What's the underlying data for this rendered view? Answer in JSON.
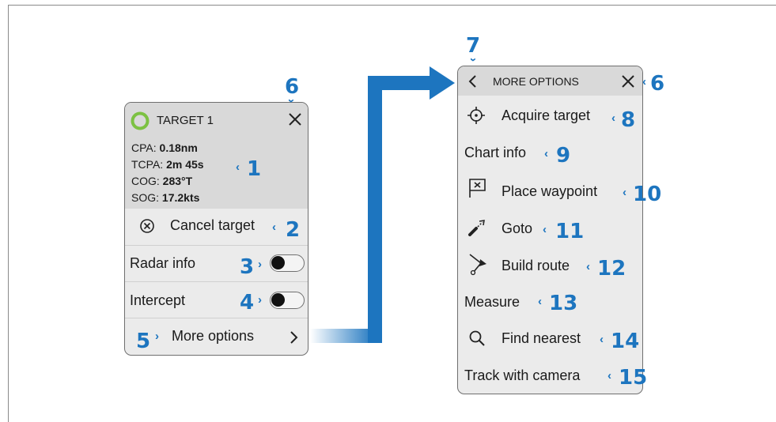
{
  "colors": {
    "accent": "#1d75bf",
    "target_ring": "#7cc142",
    "panel_bg": "#ebebeb",
    "panel_header": "#d9d9d9"
  },
  "left_panel": {
    "title": "TARGET 1",
    "info": [
      {
        "label": "CPA: ",
        "value": "0.18nm"
      },
      {
        "label": "TCPA: ",
        "value": "2m 45s"
      },
      {
        "label": "COG: ",
        "value": "283°T"
      },
      {
        "label": "SOG: ",
        "value": "17.2kts"
      }
    ],
    "cancel_label": "Cancel target",
    "radar_info_label": "Radar info",
    "intercept_label": "Intercept",
    "more_options_label": "More options",
    "radar_info_on": false,
    "intercept_on": false
  },
  "right_panel": {
    "title": "MORE OPTIONS",
    "items": [
      {
        "label": "Acquire target",
        "icon": "crosshair-icon"
      },
      {
        "label": "Chart info",
        "icon": ""
      },
      {
        "label": "Place waypoint",
        "icon": "waypoint-flag-icon"
      },
      {
        "label": "Goto",
        "icon": "goto-arrow-icon"
      },
      {
        "label": "Build route",
        "icon": "route-icon"
      },
      {
        "label": "Measure",
        "icon": ""
      },
      {
        "label": "Find nearest",
        "icon": "search-icon"
      },
      {
        "label": "Track with camera",
        "icon": ""
      }
    ]
  },
  "callouts": [
    "1",
    "2",
    "3",
    "4",
    "5",
    "6",
    "6",
    "7",
    "8",
    "9",
    "10",
    "11",
    "12",
    "13",
    "14",
    "15"
  ]
}
